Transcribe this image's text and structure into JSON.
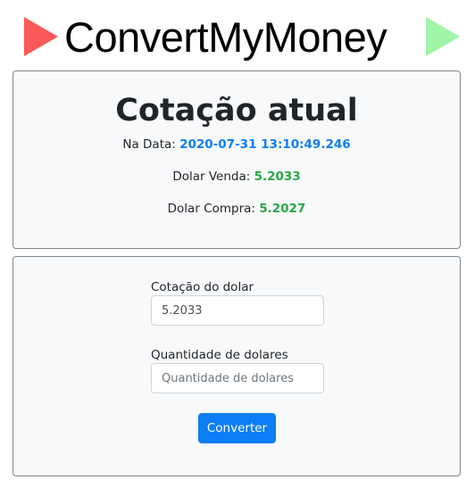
{
  "header": {
    "title": "ConvertMyMoney",
    "left_arrow": {
      "icon": "play-triangle-icon",
      "color": "#fb5858"
    },
    "right_arrow": {
      "icon": "play-triangle-icon",
      "color": "#9ef5a6"
    }
  },
  "rate_card": {
    "title": "Cotação atual",
    "date_label": "Na Data: ",
    "date_value": "2020-07-31 13:10:49.246",
    "sell_label": "Dolar Venda: ",
    "sell_value": "5.2033",
    "buy_label": "Dolar Compra: ",
    "buy_value": "5.2027"
  },
  "form": {
    "rate_label": "Cotação do dolar",
    "rate_value": "5.2033",
    "quantity_label": "Quantidade de dolares",
    "quantity_placeholder": "Quantidade de dolares",
    "submit_label": "Converter"
  },
  "colors": {
    "accent_blue": "#0d7ef3",
    "value_green": "#28a745"
  }
}
